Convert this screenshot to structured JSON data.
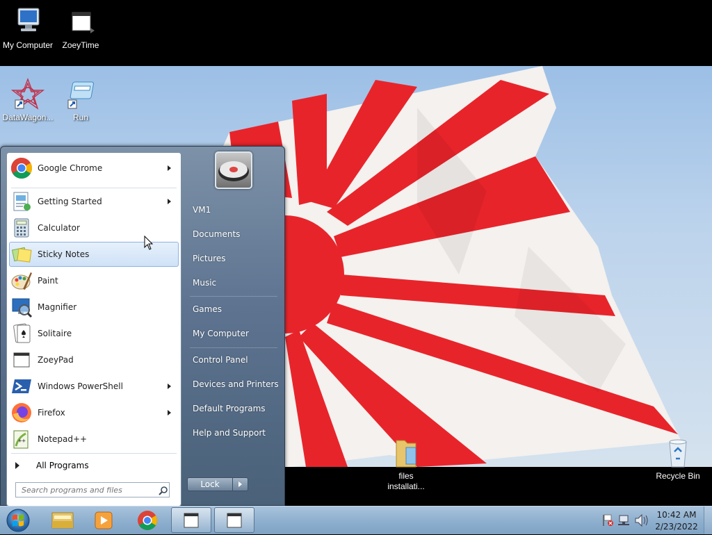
{
  "desktop": {
    "icons": [
      {
        "label": "My Computer"
      },
      {
        "label": "ZoeyTime"
      },
      {
        "label": "DataWagon..."
      },
      {
        "label": "Run"
      },
      {
        "label_line1": "files",
        "label_line2": "installati..."
      },
      {
        "label": "Recycle Bin"
      }
    ]
  },
  "start_menu": {
    "programs": [
      {
        "label": "Google Chrome",
        "icon": "chrome-icon",
        "has_submenu": true
      },
      {
        "label": "Getting Started",
        "icon": "getting-started-icon",
        "has_submenu": true
      },
      {
        "label": "Calculator",
        "icon": "calculator-icon",
        "has_submenu": false
      },
      {
        "label": "Sticky Notes",
        "icon": "sticky-notes-icon",
        "has_submenu": false,
        "highlighted": true
      },
      {
        "label": "Paint",
        "icon": "paint-icon",
        "has_submenu": false
      },
      {
        "label": "Magnifier",
        "icon": "magnifier-icon",
        "has_submenu": false
      },
      {
        "label": "Solitaire",
        "icon": "solitaire-icon",
        "has_submenu": false
      },
      {
        "label": "ZoeyPad",
        "icon": "zoeypad-icon",
        "has_submenu": false
      },
      {
        "label": "Windows PowerShell",
        "icon": "powershell-icon",
        "has_submenu": true
      },
      {
        "label": "Firefox",
        "icon": "firefox-icon",
        "has_submenu": true
      },
      {
        "label": "Notepad++",
        "icon": "notepadpp-icon",
        "has_submenu": false
      }
    ],
    "all_programs": "All Programs",
    "search_placeholder": "Search programs and files",
    "right_items": [
      {
        "label": "VM1"
      },
      {
        "label": "Documents"
      },
      {
        "label": "Pictures"
      },
      {
        "label": "Music"
      },
      {
        "label": "Games"
      },
      {
        "label": "My Computer"
      },
      {
        "label": "Control Panel"
      },
      {
        "label": "Devices and Printers"
      },
      {
        "label": "Default Programs"
      },
      {
        "label": "Help and Support"
      }
    ],
    "lock_label": "Lock"
  },
  "taskbar": {
    "pinned": [
      "windows-explorer-icon",
      "media-player-icon",
      "chrome-icon",
      "window-icon",
      "window-icon"
    ],
    "clock": {
      "time": "10:42 AM",
      "date": "2/23/2022"
    }
  },
  "colors": {
    "flag_red": "#e8242b",
    "flag_white": "#f4f1ee",
    "taskbar": "#8fb0cf",
    "start_menu_frame": "#5d7390"
  }
}
